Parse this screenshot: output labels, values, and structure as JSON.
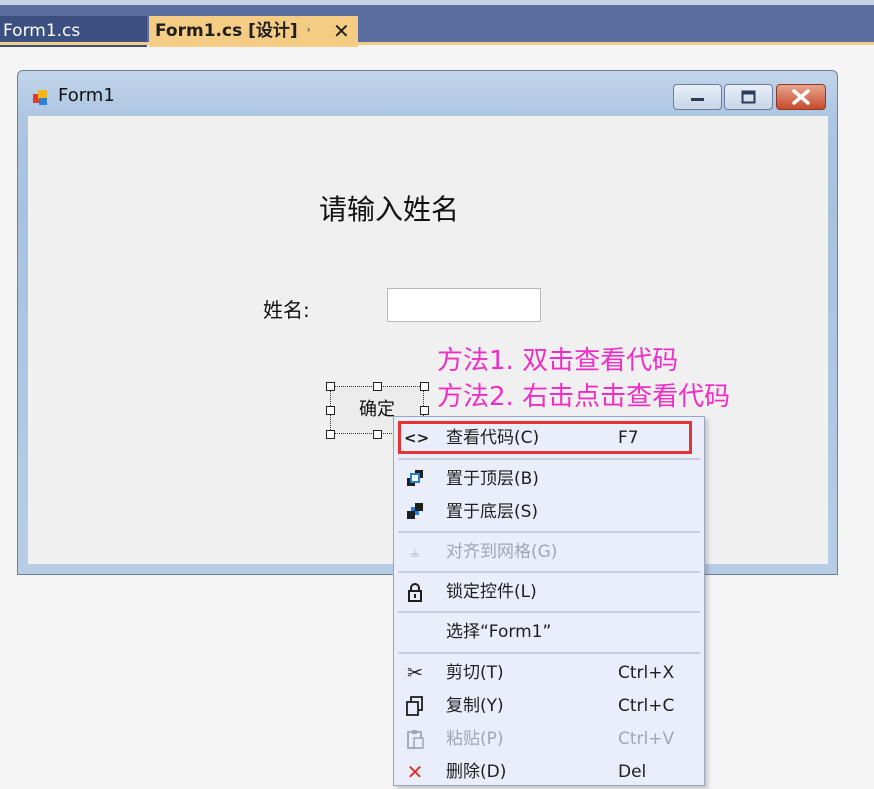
{
  "tabs": [
    {
      "label": "Form1.cs",
      "active": false
    },
    {
      "label": "Form1.cs [设计]",
      "active": true
    }
  ],
  "tab_pin_icon": "pin-icon",
  "tab_close_icon": "close-icon",
  "form": {
    "title": "Form1",
    "heading": "请输入姓名",
    "name_label": "姓名:",
    "name_value": "",
    "confirm_button": "确定"
  },
  "annotations": [
    "方法1. 双击查看代码",
    "方法2. 右击点击查看代码"
  ],
  "context_menu": {
    "items": [
      {
        "icon": "code-brackets-icon",
        "label": "查看代码(C)",
        "shortcut": "F7",
        "enabled": true,
        "highlighted": true
      },
      {
        "icon": "bring-to-front-icon",
        "label": "置于顶层(B)",
        "shortcut": "",
        "enabled": true
      },
      {
        "icon": "send-to-back-icon",
        "label": "置于底层(S)",
        "shortcut": "",
        "enabled": true
      },
      {
        "icon": "align-to-grid-icon",
        "label": "对齐到网格(G)",
        "shortcut": "",
        "enabled": false
      },
      {
        "icon": "lock-icon",
        "label": "锁定控件(L)",
        "shortcut": "",
        "enabled": true
      },
      {
        "icon": "",
        "label": "选择“Form1”",
        "shortcut": "",
        "enabled": true
      },
      {
        "icon": "scissors-icon",
        "label": "剪切(T)",
        "shortcut": "Ctrl+X",
        "enabled": true
      },
      {
        "icon": "copy-icon",
        "label": "复制(Y)",
        "shortcut": "Ctrl+C",
        "enabled": true
      },
      {
        "icon": "paste-icon",
        "label": "粘贴(P)",
        "shortcut": "Ctrl+V",
        "enabled": false
      },
      {
        "icon": "delete-icon",
        "label": "删除(D)",
        "shortcut": "Del",
        "enabled": true
      }
    ]
  },
  "colors": {
    "annotation": "#ee2ec6",
    "highlight_box": "#e8322f",
    "active_tab": "#f5cc84",
    "tab_bar": "#5b6d9e"
  }
}
